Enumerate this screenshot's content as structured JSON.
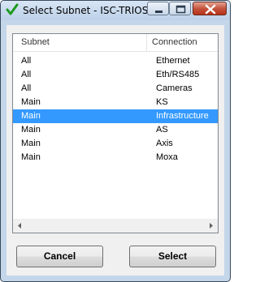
{
  "window": {
    "title": "Select Subnet - ISC-TRIOS..."
  },
  "columns": {
    "subnet": "Subnet",
    "connection": "Connection"
  },
  "rows": [
    {
      "subnet": "All",
      "connection": "Ethernet"
    },
    {
      "subnet": "All",
      "connection": "Eth/RS485"
    },
    {
      "subnet": "All",
      "connection": "Cameras"
    },
    {
      "subnet": "Main",
      "connection": "KS"
    },
    {
      "subnet": "Main",
      "connection": "Infrastructure"
    },
    {
      "subnet": "Main",
      "connection": "AS"
    },
    {
      "subnet": "Main",
      "connection": "Axis"
    },
    {
      "subnet": "Main",
      "connection": "Moxa"
    }
  ],
  "selected_row_index": 4,
  "buttons": {
    "cancel": "Cancel",
    "select": "Select"
  },
  "icons": {
    "title": "checkmark-icon",
    "minimize": "minimize-icon",
    "maximize": "maximize-icon",
    "close": "close-icon"
  },
  "colors": {
    "selection": "#3399ff",
    "close_button": "#c4543d",
    "checkmark": "#1e9a1e"
  }
}
